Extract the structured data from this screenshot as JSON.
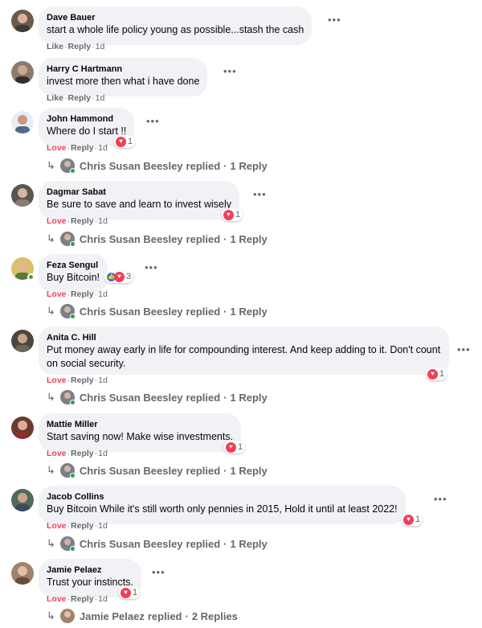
{
  "comments": [
    {
      "author": "Dave Bauer",
      "text": "start a whole life policy young as possible...stash the cash",
      "reaction_action": "Like",
      "reply_action": "Reply",
      "time": "1d"
    },
    {
      "author": "Harry C Hartmann",
      "text": "invest more then what i have done",
      "reaction_action": "Like",
      "reply_action": "Reply",
      "time": "1d"
    },
    {
      "author": "John Hammond",
      "text": "Where do I start !!",
      "reaction_action": "Love",
      "reply_action": "Reply",
      "time": "1d",
      "reaction_count": "1",
      "replies_summary": {
        "name": "Chris Susan Beesley",
        "verb": "replied",
        "count": "1 Reply"
      }
    },
    {
      "author": "Dagmar Sabat",
      "text": "Be sure to save and learn to invest wisely",
      "reaction_action": "Love",
      "reply_action": "Reply",
      "time": "1d",
      "reaction_count": "1",
      "replies_summary": {
        "name": "Chris Susan Beesley",
        "verb": "replied",
        "count": "1 Reply"
      }
    },
    {
      "author": "Feza Sengul",
      "text": "Buy Bitcoin!",
      "reaction_action": "Love",
      "reply_action": "Reply",
      "time": "1d",
      "reaction_count": "3",
      "replies_summary": {
        "name": "Chris Susan Beesley",
        "verb": "replied",
        "count": "1 Reply"
      }
    },
    {
      "author": "Anita C. Hill",
      "text": "Put money away early in life for compounding interest. And keep adding to it. Don't count on social security.",
      "reaction_action": "Love",
      "reply_action": "Reply",
      "time": "1d",
      "reaction_count": "1",
      "replies_summary": {
        "name": "Chris Susan Beesley",
        "verb": "replied",
        "count": "1 Reply"
      }
    },
    {
      "author": "Mattie Miller",
      "text": "Start saving now! Make wise investments.",
      "reaction_action": "Love",
      "reply_action": "Reply",
      "time": "1d",
      "reaction_count": "1",
      "replies_summary": {
        "name": "Chris Susan Beesley",
        "verb": "replied",
        "count": "1 Reply"
      }
    },
    {
      "author": "Jacob Collins",
      "text": "Buy Bitcoin While it's still worth only pennies in 2015, Hold it until at least 2022!",
      "reaction_action": "Love",
      "reply_action": "Reply",
      "time": "1d",
      "reaction_count": "1",
      "replies_summary": {
        "name": "Chris Susan Beesley",
        "verb": "replied",
        "count": "1 Reply"
      }
    },
    {
      "author": "Jamie Pelaez",
      "text": "Trust your instincts.",
      "reaction_action": "Love",
      "reply_action": "Reply",
      "time": "1d",
      "reaction_count": "1",
      "replies_summary": {
        "name": "Jamie Pelaez",
        "verb": "replied",
        "count": "2 Replies"
      }
    }
  ],
  "ui": {
    "separator": "·",
    "more_options": "•••",
    "reply_arrow": "↳",
    "reply_separator": "·"
  },
  "icons": {
    "more": "more-options-icon",
    "love": "love-reaction-icon",
    "like": "like-reaction-icon",
    "reply_arrow": "reply-arrow-icon"
  },
  "colors": {
    "bubble": "#f0f2f5",
    "love": "#f33e58",
    "like": "#1877f2",
    "muted": "#65676b",
    "online": "#31a24c"
  }
}
